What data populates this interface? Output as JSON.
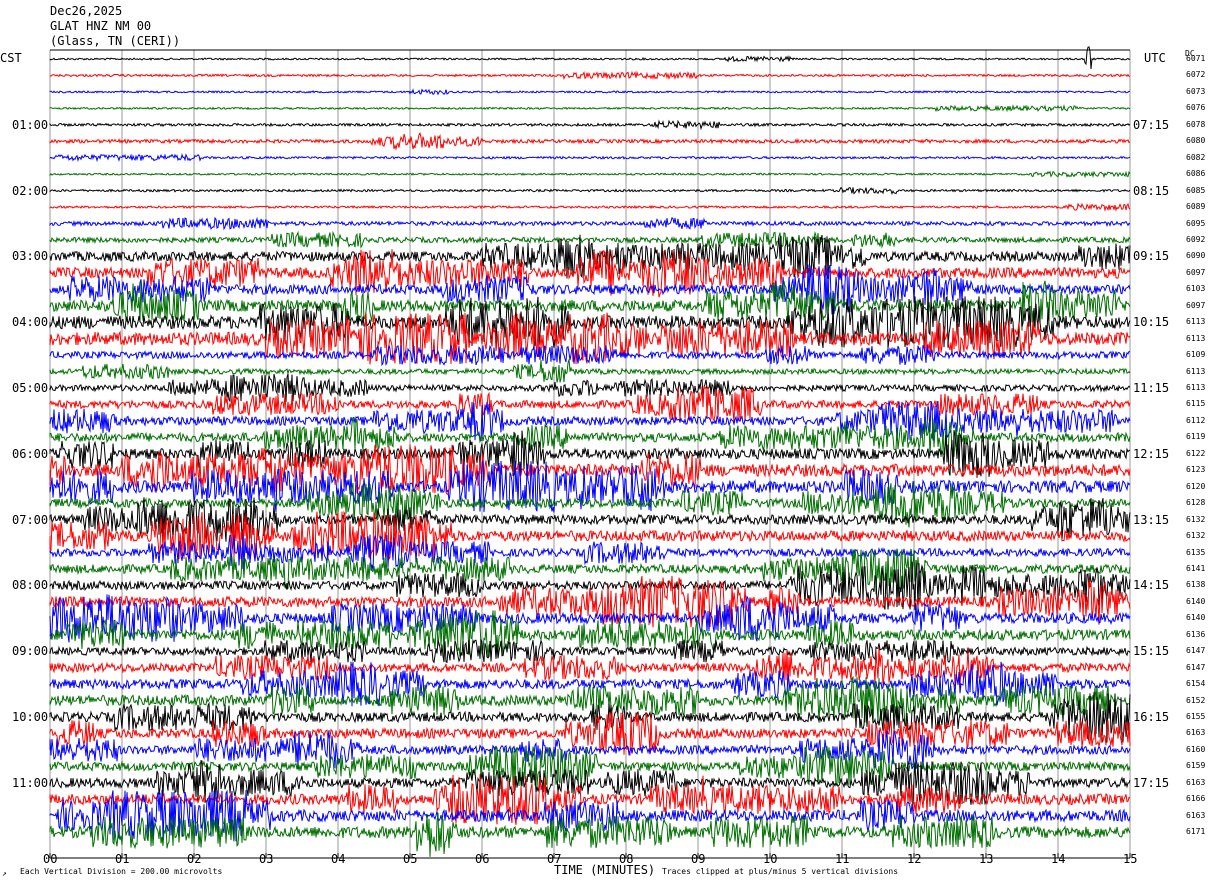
{
  "header": {
    "date": "Dec26,2025",
    "station": "GLAT HNZ NM 00",
    "location": "(Glass, TN (CERI))"
  },
  "left_tz": "CST",
  "right_tz": "UTC",
  "dc_label": "DC",
  "left_times": [
    "01:00",
    "02:00",
    "03:00",
    "04:00",
    "05:00",
    "06:00",
    "07:00",
    "08:00",
    "09:00",
    "10:00",
    "11:00"
  ],
  "right_times": [
    "07:15",
    "08:15",
    "09:15",
    "10:15",
    "11:15",
    "12:15",
    "13:15",
    "14:15",
    "15:15",
    "16:15",
    "17:15"
  ],
  "footer": {
    "scale": "Each Vertical Division =  200.00 microvolts",
    "xlabel": "TIME (MINUTES)",
    "clip": "Traces clipped at plus/minus 5 vertical divisions"
  },
  "chart_data": {
    "type": "line",
    "title": "GLAT HNZ NM 00",
    "xlabel": "TIME (MINUTES)",
    "xlim": [
      0,
      15
    ],
    "x_ticks": [
      "00",
      "01",
      "02",
      "03",
      "04",
      "05",
      "06",
      "07",
      "08",
      "09",
      "10",
      "11",
      "12",
      "13",
      "14",
      "15"
    ],
    "trace_colors": [
      "#000000",
      "#ff0000",
      "#0000ff",
      "#007000"
    ],
    "dc_offsets": [
      "6071",
      "6072",
      "6073",
      "6076",
      "6078",
      "6080",
      "6082",
      "6086",
      "6085",
      "6089",
      "6095",
      "6092",
      "6090",
      "6097",
      "6103",
      "6097",
      "6113",
      "6113",
      "6109",
      "6113",
      "6113",
      "6115",
      "6112",
      "6119",
      "6122",
      "6123",
      "6120",
      "6128",
      "6132",
      "6132",
      "6135",
      "6141",
      "6138",
      "6140",
      "6140",
      "6136",
      "6147",
      "6147",
      "6154",
      "6152",
      "6155",
      "6163",
      "6160",
      "6159",
      "6163",
      "6166",
      "6163",
      "6171"
    ],
    "amplitude": [
      0.4,
      0.5,
      0.4,
      0.4,
      0.6,
      0.8,
      0.5,
      0.4,
      0.5,
      0.5,
      0.9,
      1.2,
      2.2,
      2.4,
      2.2,
      2.6,
      3,
      3,
      1.6,
      1.2,
      1.4,
      1.8,
      2,
      2,
      2.4,
      2.8,
      2.8,
      2,
      2.2,
      2.4,
      1.8,
      2,
      2,
      2.4,
      2.4,
      2.4,
      1.8,
      2,
      2.2,
      2.4,
      2.2,
      2.2,
      2,
      2,
      2.2,
      2.4,
      2.6,
      2.6
    ],
    "grid": true
  }
}
